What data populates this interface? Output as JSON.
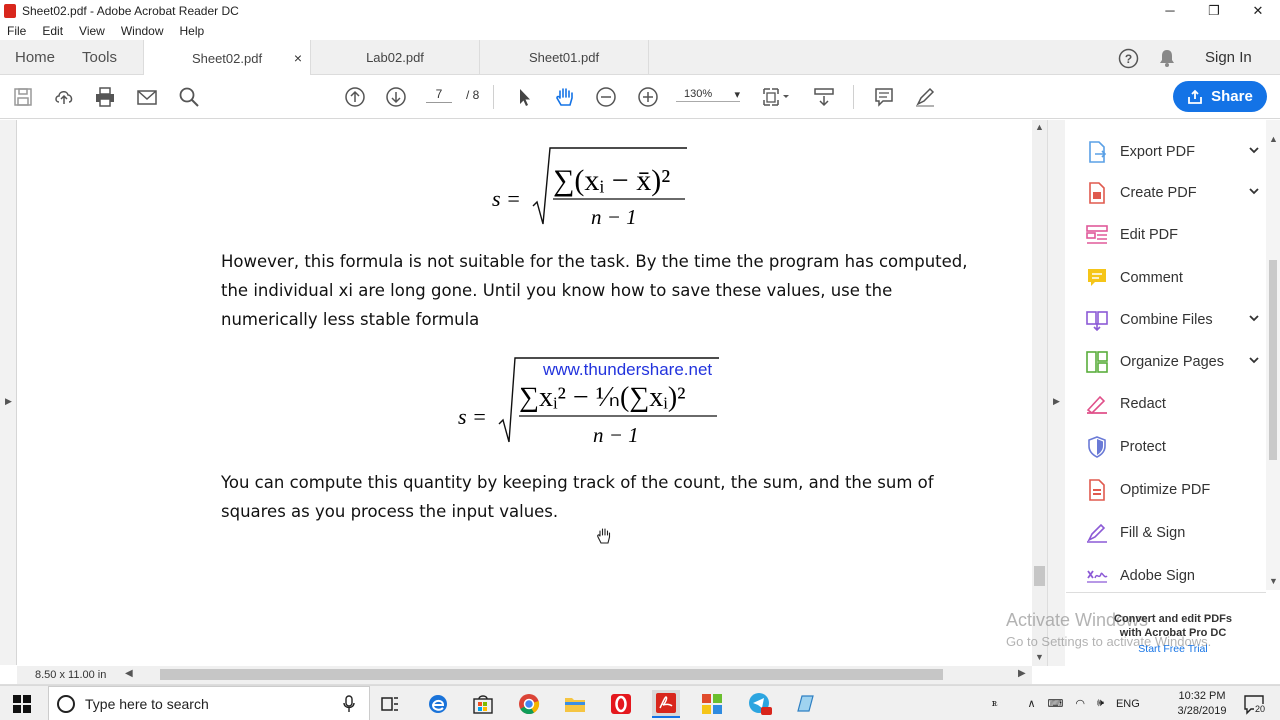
{
  "window": {
    "title": "Sheet02.pdf - Adobe Acrobat Reader DC",
    "minimize": "─",
    "maximize": "❐",
    "close": "✕"
  },
  "menu": [
    "File",
    "Edit",
    "View",
    "Window",
    "Help"
  ],
  "nav_tabs": {
    "home": "Home",
    "tools": "Tools"
  },
  "doc_tabs": [
    {
      "label": "Sheet02.pdf",
      "active": true
    },
    {
      "label": "Lab02.pdf",
      "active": false
    },
    {
      "label": "Sheet01.pdf",
      "active": false
    }
  ],
  "tab_close": "×",
  "header_right": {
    "sign_in": "Sign In",
    "help": "?"
  },
  "toolbar": {
    "page_current": "7",
    "page_total": "/ 8",
    "zoom": "130%",
    "share_label": "Share"
  },
  "document": {
    "para1": "However, this formula is not suitable for the task. By the time the program has computed, the individual xi are long gone. Until you know how to save these values, use the numerically less stable formula",
    "para2": "You can compute this quantity by keeping track of the count, the sum, and the sum of squares as you process the input values.",
    "watermark": "www.thundershare.net",
    "formula1": {
      "lhs": "s =",
      "numerator": "∑(xᵢ − x̄)²",
      "denominator": "n − 1"
    },
    "formula2": {
      "lhs": "s =",
      "numerator": "∑xᵢ² − ¹⁄ₙ(∑xᵢ)²",
      "denominator": "n − 1"
    }
  },
  "status": {
    "page_size": "8.50 x 11.00 in"
  },
  "right_panel": {
    "items": [
      {
        "label": "Export PDF",
        "icon": "export-pdf-icon",
        "color": "#5aa0e6",
        "chevron": true
      },
      {
        "label": "Create PDF",
        "icon": "create-pdf-icon",
        "color": "#e05a4e",
        "chevron": true
      },
      {
        "label": "Edit PDF",
        "icon": "edit-pdf-icon",
        "color": "#e05a9a",
        "chevron": false
      },
      {
        "label": "Comment",
        "icon": "comment-icon",
        "color": "#f5c518",
        "chevron": false
      },
      {
        "label": "Combine Files",
        "icon": "combine-files-icon",
        "color": "#8c5ad6",
        "chevron": true
      },
      {
        "label": "Organize Pages",
        "icon": "organize-pages-icon",
        "color": "#5aad3c",
        "chevron": true
      },
      {
        "label": "Redact",
        "icon": "redact-icon",
        "color": "#e0508a",
        "chevron": false
      },
      {
        "label": "Protect",
        "icon": "protect-icon",
        "color": "#6a7ad6",
        "chevron": false
      },
      {
        "label": "Optimize PDF",
        "icon": "optimize-pdf-icon",
        "color": "#e05a4e",
        "chevron": false
      },
      {
        "label": "Fill & Sign",
        "icon": "fill-sign-icon",
        "color": "#8c5ad6",
        "chevron": false
      },
      {
        "label": "Adobe Sign",
        "icon": "adobe-sign-icon",
        "color": "#8c5ad6",
        "chevron": false
      }
    ],
    "promo_line1": "Convert and edit PDFs",
    "promo_line2": "with Acrobat Pro DC",
    "promo_link": "Start Free Trial"
  },
  "activation": {
    "line1": "Activate Windows",
    "line2": "Go to Settings to activate Windows."
  },
  "taskbar": {
    "search_placeholder": "Type here to search",
    "language": "ENG",
    "time": "10:32 PM",
    "date": "3/28/2019",
    "notification_count": "20"
  }
}
